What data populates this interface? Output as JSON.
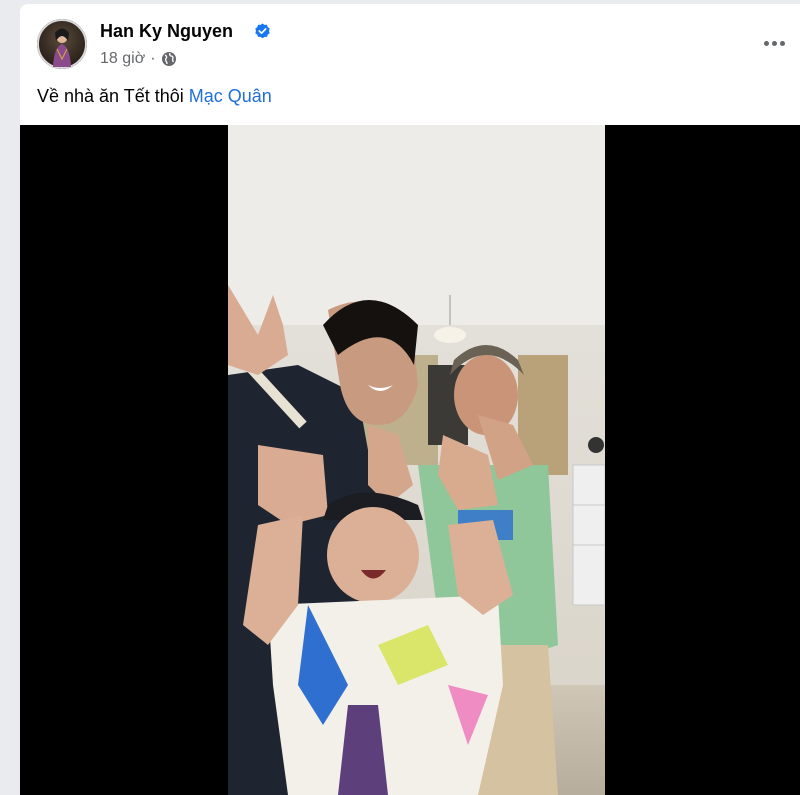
{
  "post": {
    "author": "Han Ky Nguyen",
    "timestamp": "18 giờ",
    "separator": "·",
    "caption_text": "Về nhà ăn Tết thôi ",
    "caption_mention": "Mạc Quân"
  },
  "icons": {
    "verified": "verified-badge-icon",
    "audience": "globe-icon",
    "more": "more-options-icon"
  },
  "colors": {
    "mention": "#216fdb",
    "verified": "#1877f2",
    "video_bg": "#000000"
  }
}
